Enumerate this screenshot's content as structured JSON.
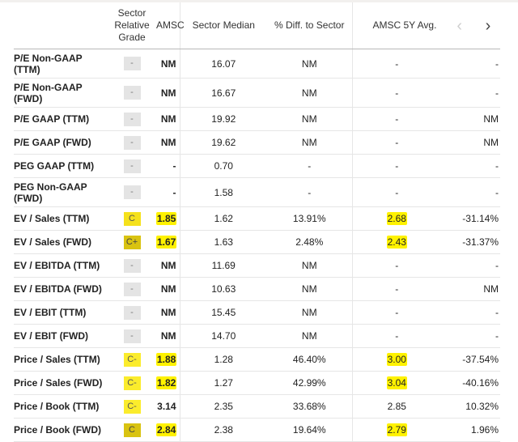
{
  "header": {
    "metric": "",
    "grade": "Sector Relative Grade",
    "grade_lines": [
      "Sector",
      "Relative",
      "Grade"
    ],
    "amsc": "AMSC",
    "sector_median": "Sector Median",
    "diff": "% Diff. to Sector",
    "avg5y": "AMSC 5Y Avg.",
    "nav_prev": "‹",
    "nav_next": "›"
  },
  "rows": [
    {
      "metric": "P/E Non-GAAP (TTM)",
      "grade": "-",
      "grade_style": "none",
      "amsc": "NM",
      "amsc_hl": false,
      "median": "16.07",
      "diff": "NM",
      "avg": "-",
      "avg_hl": false,
      "last": "-",
      "tall": true
    },
    {
      "metric": "P/E Non-GAAP (FWD)",
      "grade": "-",
      "grade_style": "none",
      "amsc": "NM",
      "amsc_hl": false,
      "median": "16.67",
      "diff": "NM",
      "avg": "-",
      "avg_hl": false,
      "last": "-",
      "tall": true
    },
    {
      "metric": "P/E GAAP (TTM)",
      "grade": "-",
      "grade_style": "none",
      "amsc": "NM",
      "amsc_hl": false,
      "median": "19.92",
      "diff": "NM",
      "avg": "-",
      "avg_hl": false,
      "last": "NM",
      "tall": false
    },
    {
      "metric": "P/E GAAP (FWD)",
      "grade": "-",
      "grade_style": "none",
      "amsc": "NM",
      "amsc_hl": false,
      "median": "19.62",
      "diff": "NM",
      "avg": "-",
      "avg_hl": false,
      "last": "NM",
      "tall": false
    },
    {
      "metric": "PEG GAAP (TTM)",
      "grade": "-",
      "grade_style": "none",
      "amsc": "-",
      "amsc_hl": false,
      "median": "0.70",
      "diff": "-",
      "avg": "-",
      "avg_hl": false,
      "last": "-",
      "tall": false
    },
    {
      "metric": "PEG Non-GAAP (FWD)",
      "grade": "-",
      "grade_style": "none",
      "amsc": "-",
      "amsc_hl": false,
      "median": "1.58",
      "diff": "-",
      "avg": "-",
      "avg_hl": false,
      "last": "-",
      "tall": true
    },
    {
      "metric": "EV / Sales (TTM)",
      "grade": "C",
      "grade_style": "c",
      "amsc": "1.85",
      "amsc_hl": true,
      "median": "1.62",
      "diff": "13.91%",
      "avg": "2.68",
      "avg_hl": true,
      "last": "-31.14%",
      "tall": false
    },
    {
      "metric": "EV / Sales (FWD)",
      "grade": "C+",
      "grade_style": "cplus",
      "amsc": "1.67",
      "amsc_hl": true,
      "median": "1.63",
      "diff": "2.48%",
      "avg": "2.43",
      "avg_hl": true,
      "last": "-31.37%",
      "tall": false
    },
    {
      "metric": "EV / EBITDA (TTM)",
      "grade": "-",
      "grade_style": "none",
      "amsc": "NM",
      "amsc_hl": false,
      "median": "11.69",
      "diff": "NM",
      "avg": "-",
      "avg_hl": false,
      "last": "-",
      "tall": false
    },
    {
      "metric": "EV / EBITDA (FWD)",
      "grade": "-",
      "grade_style": "none",
      "amsc": "NM",
      "amsc_hl": false,
      "median": "10.63",
      "diff": "NM",
      "avg": "-",
      "avg_hl": false,
      "last": "NM",
      "tall": false
    },
    {
      "metric": "EV / EBIT (TTM)",
      "grade": "-",
      "grade_style": "none",
      "amsc": "NM",
      "amsc_hl": false,
      "median": "15.45",
      "diff": "NM",
      "avg": "-",
      "avg_hl": false,
      "last": "-",
      "tall": false
    },
    {
      "metric": "EV / EBIT (FWD)",
      "grade": "-",
      "grade_style": "none",
      "amsc": "NM",
      "amsc_hl": false,
      "median": "14.70",
      "diff": "NM",
      "avg": "-",
      "avg_hl": false,
      "last": "-",
      "tall": false
    },
    {
      "metric": "Price / Sales (TTM)",
      "grade": "C-",
      "grade_style": "cminus",
      "amsc": "1.88",
      "amsc_hl": true,
      "median": "1.28",
      "diff": "46.40%",
      "avg": "3.00",
      "avg_hl": true,
      "last": "-37.54%",
      "tall": false
    },
    {
      "metric": "Price / Sales (FWD)",
      "grade": "C-",
      "grade_style": "cminus",
      "amsc": "1.82",
      "amsc_hl": true,
      "median": "1.27",
      "diff": "42.99%",
      "avg": "3.04",
      "avg_hl": true,
      "last": "-40.16%",
      "tall": false
    },
    {
      "metric": "Price / Book (TTM)",
      "grade": "C-",
      "grade_style": "cminus",
      "amsc": "3.14",
      "amsc_hl": false,
      "median": "2.35",
      "diff": "33.68%",
      "avg": "2.85",
      "avg_hl": false,
      "last": "10.32%",
      "tall": false
    },
    {
      "metric": "Price / Book (FWD)",
      "grade": "C",
      "grade_style": "cplus",
      "amsc": "2.84",
      "amsc_hl": true,
      "median": "2.38",
      "diff": "19.64%",
      "avg": "2.79",
      "avg_hl": true,
      "last": "1.96%",
      "tall": false
    }
  ]
}
